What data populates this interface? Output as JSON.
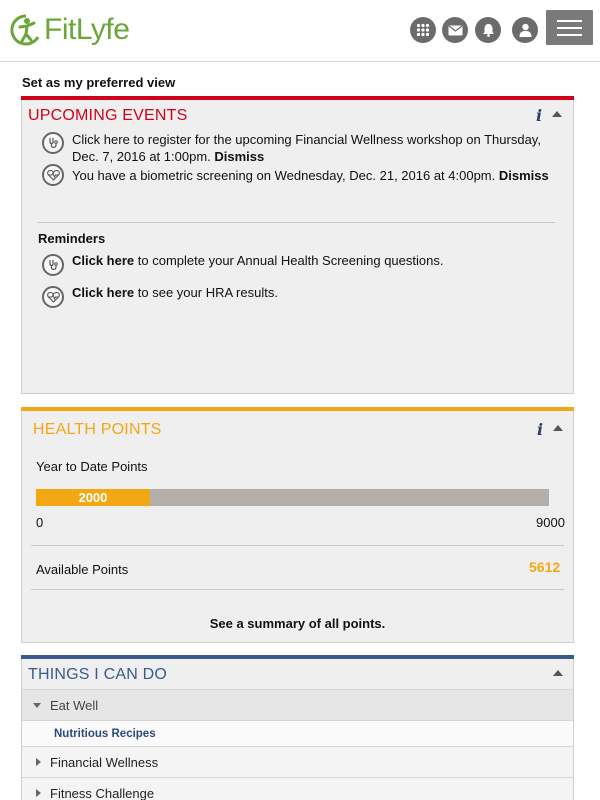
{
  "header": {
    "logo_text": "FitLyfe",
    "icons": [
      "apps-grid-icon",
      "mail-icon",
      "bell-icon",
      "user-icon",
      "menu-icon"
    ]
  },
  "preferred_view_label": "Set as my preferred view",
  "upcoming_events": {
    "title": "UPCOMING EVENTS",
    "accent_color": "#d0021b",
    "events": [
      {
        "icon": "stethoscope-icon",
        "text_line1": "Click here to register for the upcoming Financial Wellness workshop on Thursday,",
        "text_line2": "Dec. 7, 2016 at 1:00pm.",
        "action": "Dismiss"
      },
      {
        "icon": "heart-monitor-icon",
        "text": "You have a biometric screening on Wednesday, Dec. 21, 2016 at 4:00pm.",
        "action": "Dismiss"
      }
    ],
    "reminders_label": "Reminders",
    "reminders": [
      {
        "icon": "stethoscope-icon",
        "link": "Click here",
        "text": " to complete your Annual Health Screening questions."
      },
      {
        "icon": "heart-monitor-icon",
        "link": "Click here",
        "text": " to see your HRA results."
      }
    ]
  },
  "health_points": {
    "title": "HEALTH POINTS",
    "accent_color": "#f3a712",
    "ytd_label": "Year to Date Points",
    "ytd_value": "2000",
    "ytd_fraction": 0.222,
    "min_label": "0",
    "max_label": "9000",
    "available_label": "Available Points",
    "available_value": "5612",
    "summary_link": "See a summary of all points."
  },
  "things_i_can_do": {
    "title": "THINGS I CAN DO",
    "accent_color": "#3a5a8c",
    "sections": [
      {
        "label": "Eat Well",
        "expanded": true,
        "children": [
          "Nutritious Recipes"
        ]
      },
      {
        "label": "Financial Wellness",
        "expanded": false
      },
      {
        "label": "Fitness Challenge",
        "expanded": false
      }
    ]
  }
}
